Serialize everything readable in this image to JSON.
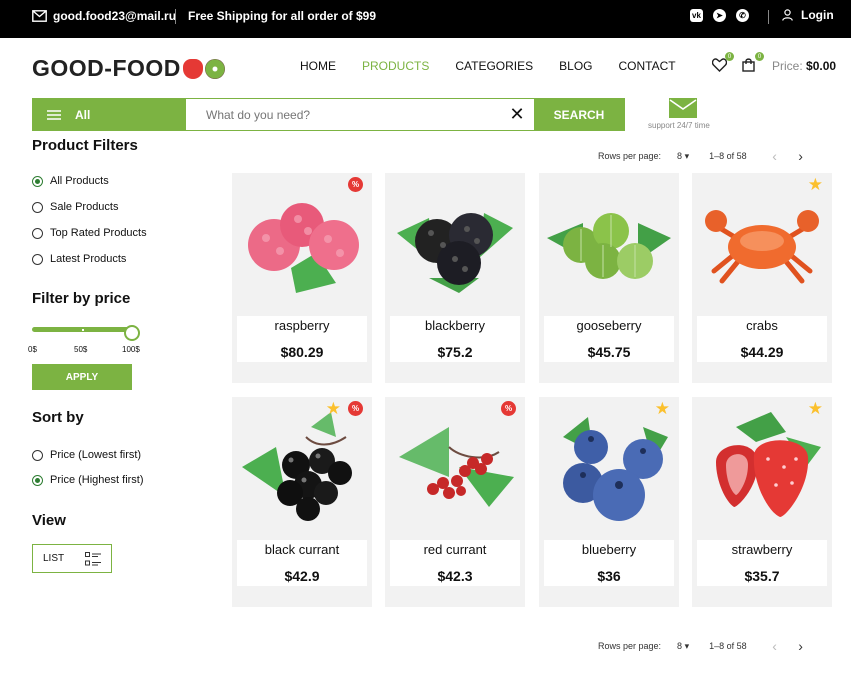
{
  "topbar": {
    "email": "good.food23@mail.ru",
    "shipping": "Free Shipping for all order of $99",
    "login": "Login"
  },
  "header": {
    "logo": "GOOD-FOOD",
    "nav": [
      "HOME",
      "PRODUCTS",
      "CATEGORIES",
      "BLOG",
      "CONTACT"
    ],
    "wishlist_count": "0",
    "cart_count": "0",
    "price_label": "Price:",
    "price_value": "$0.00"
  },
  "search": {
    "category": "All",
    "placeholder": "What do you need?",
    "button": "SEARCH",
    "support": "support 24/7 time"
  },
  "filters": {
    "title": "Product Filters",
    "options": [
      "All Products",
      "Sale Products",
      "Top Rated Products",
      "Latest Products"
    ],
    "price_title": "Filter by price",
    "price_labels": [
      "0$",
      "50$",
      "100$"
    ],
    "price_level": 1.0,
    "apply": "APPLY",
    "sort_title": "Sort by",
    "sort_options": [
      "Price (Lowest first)",
      "Price (Highest first)"
    ],
    "view_title": "View",
    "view_label": "LIST"
  },
  "pager": {
    "rows_label": "Rows per page:",
    "rows_value": "8",
    "range": "1–8 of 58"
  },
  "colors": {
    "accent": "#7cb342",
    "sale": "#e53935",
    "star": "#fbc02d"
  },
  "products": [
    {
      "name": "raspberry",
      "price": "$80.29",
      "sale": true,
      "star": false
    },
    {
      "name": "blackberry",
      "price": "$75.2",
      "sale": false,
      "star": false
    },
    {
      "name": "gooseberry",
      "price": "$45.75",
      "sale": false,
      "star": false
    },
    {
      "name": "crabs",
      "price": "$44.29",
      "sale": false,
      "star": true
    },
    {
      "name": "black currant",
      "price": "$42.9",
      "sale": true,
      "star": true
    },
    {
      "name": "red currant",
      "price": "$42.3",
      "sale": true,
      "star": false
    },
    {
      "name": "blueberry",
      "price": "$36",
      "sale": false,
      "star": true
    },
    {
      "name": "strawberry",
      "price": "$35.7",
      "sale": false,
      "star": true
    }
  ]
}
